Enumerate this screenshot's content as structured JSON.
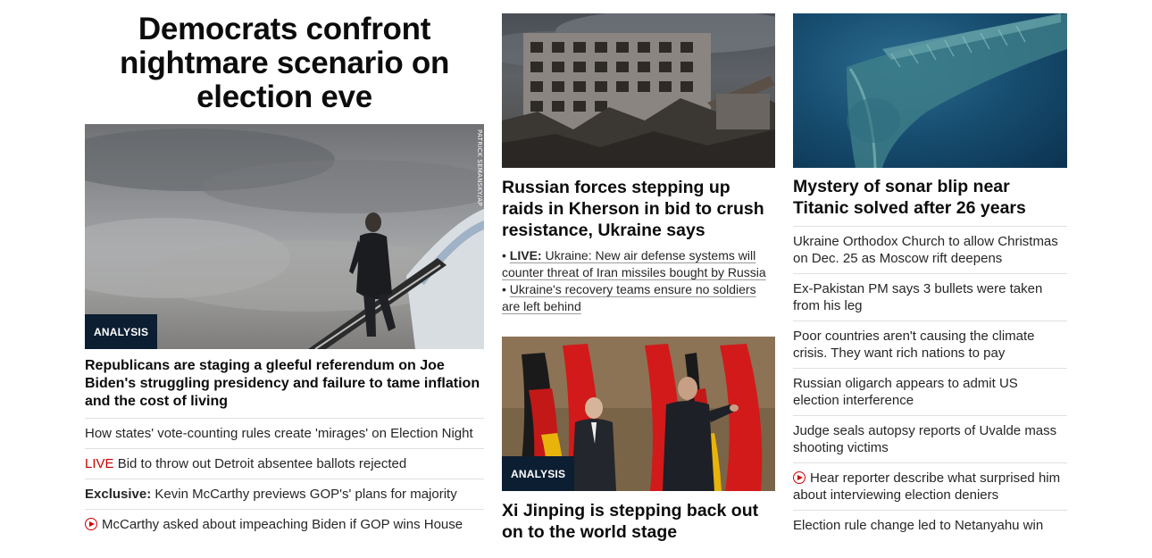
{
  "col1": {
    "headline": "Democrats confront nightmare scenario on election eve",
    "photo_credit": "PATRICK SEMANSKY/AP",
    "badge": "ANALYSIS",
    "subheadline": "Republicans are staging a gleeful referendum on Joe Biden's struggling presidency and failure to tame inflation and the cost of living",
    "links": [
      {
        "prefix": "",
        "text": "How states' vote-counting rules create 'mirages' on Election Night"
      },
      {
        "prefix": "LIVE",
        "text": " Bid to throw out Detroit absentee ballots rejected"
      },
      {
        "prefix": "Exclusive:",
        "text": " Kevin McCarthy previews GOP's' plans for majority"
      },
      {
        "prefix": "",
        "text": "McCarthy asked about impeaching Biden if GOP wins House",
        "icon": "play-icon"
      }
    ]
  },
  "col2": {
    "story1": {
      "headline": "Russian forces stepping up raids in Kherson in bid to crush resistance, Ukraine says",
      "bullet1_prefix": "LIVE:",
      "bullet1_text": " Ukraine: New air defense systems will counter threat of Iran missiles bought by Russia",
      "bullet2_text": "Ukraine's recovery teams ensure no soldiers are left behind"
    },
    "story2": {
      "badge": "ANALYSIS",
      "headline": "Xi Jinping is stepping back out on to the world stage"
    }
  },
  "col3": {
    "headline": "Mystery of sonar blip near Titanic solved after 26 years",
    "links": [
      {
        "text": "Ukraine Orthodox Church to allow Christmas on Dec. 25 as Moscow rift deepens"
      },
      {
        "text": "Ex-Pakistan PM says 3 bullets were taken from his leg"
      },
      {
        "text": "Poor countries aren't causing the climate crisis. They want rich nations to pay"
      },
      {
        "text": "Russian oligarch appears to admit US election interference"
      },
      {
        "text": "Judge seals autopsy reports of Uvalde mass shooting victims"
      },
      {
        "text": "Hear reporter describe what surprised him about interviewing election deniers",
        "icon": "play-icon"
      },
      {
        "text": "Election rule change led to Netanyahu win"
      }
    ]
  },
  "colors": {
    "live_red": "#cc0000",
    "badge_bg": "#0c1e32",
    "divider": "#e0e0e0",
    "text": "#0c0c0c"
  }
}
